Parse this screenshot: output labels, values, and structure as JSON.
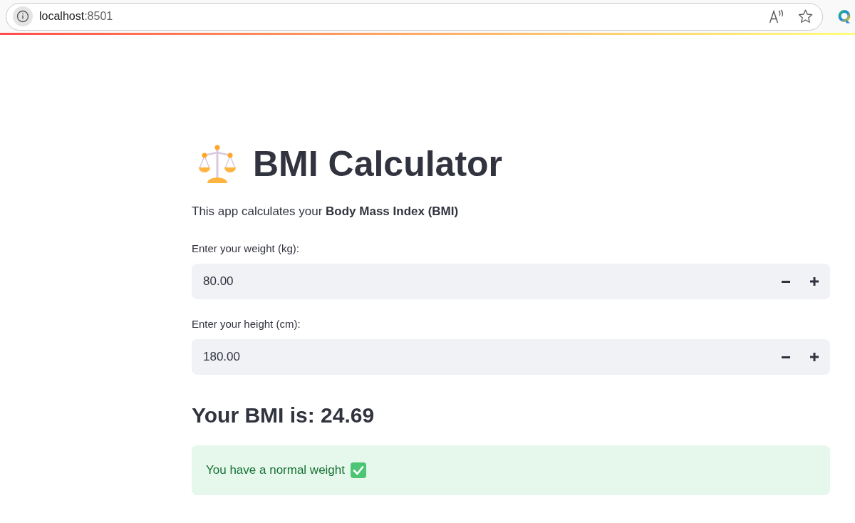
{
  "browser": {
    "address": {
      "host": "localhost",
      "port": ":8501"
    }
  },
  "app": {
    "title": "BMI Calculator",
    "description": "This app calculates your **Body Mass Index (BMI)**",
    "inputs": [
      {
        "label": "Enter your weight (kg):",
        "value": "80.00"
      },
      {
        "label": "Enter your height (cm):",
        "value": "180.00"
      }
    ],
    "result": "Your BMI is: 24.69",
    "alert": {
      "kind": "success",
      "text": "You have a normal weight"
    }
  }
}
